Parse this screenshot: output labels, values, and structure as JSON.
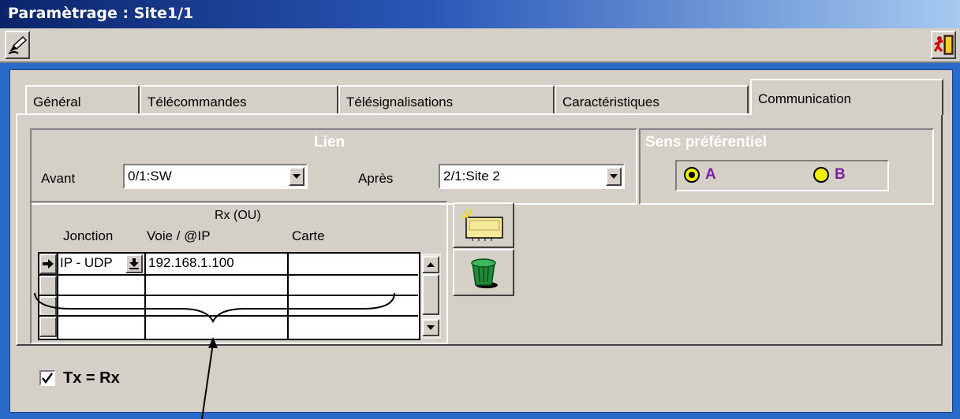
{
  "window": {
    "title": "Paramètrage : Site1/1"
  },
  "toolbar": {
    "edit_icon": "pen-hand-icon",
    "exit_icon": "exit-runner-icon"
  },
  "tabs": [
    {
      "label": "Général"
    },
    {
      "label": "Télécommandes"
    },
    {
      "label": "Télésignalisations"
    },
    {
      "label": "Caractéristiques"
    },
    {
      "label": "Communication"
    }
  ],
  "active_tab": "Communication",
  "lien": {
    "title": "Lien",
    "avant_label": "Avant",
    "avant_value": "0/1:SW",
    "apres_label": "Après",
    "apres_value": "2/1:Site 2"
  },
  "sens": {
    "title": "Sens préférentiel",
    "option_a": "A",
    "option_b": "B",
    "selected": "A"
  },
  "grid": {
    "header_rx": "Rx (OU)",
    "col_jonction": "Jonction",
    "col_voie": "Voie / @IP",
    "col_carte": "Carte",
    "rows": [
      {
        "jonction": "IP - UDP",
        "voie": "192.168.1.100",
        "carte": ""
      },
      {
        "jonction": "",
        "voie": "",
        "carte": ""
      },
      {
        "jonction": "",
        "voie": "",
        "carte": ""
      },
      {
        "jonction": "",
        "voie": "",
        "carte": ""
      }
    ]
  },
  "buttons": {
    "add_icon": "new-card-icon",
    "delete_icon": "trash-bin-icon"
  },
  "txrx": {
    "label": "Tx = Rx",
    "checked": true
  },
  "colors": {
    "titlebar": "#0a246a",
    "frame": "#2a6ac8",
    "panel": "#d4d0c8",
    "radio_fill": "#f2ee00",
    "radio_label": "#7a1fa0"
  }
}
